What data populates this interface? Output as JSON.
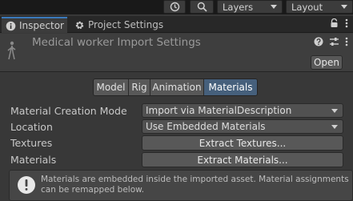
{
  "toolbar": {
    "history_icon": "history-icon",
    "search_icon": "search-icon",
    "layers_label": "Layers",
    "layout_label": "Layout"
  },
  "tabs": [
    {
      "label": "Inspector",
      "icon": "info-icon",
      "active": true
    },
    {
      "label": "Project Settings",
      "icon": "gear-icon",
      "active": false
    }
  ],
  "header": {
    "title": "Medical worker Import Settings",
    "open_label": "Open"
  },
  "segments": [
    {
      "label": "Model",
      "active": false
    },
    {
      "label": "Rig",
      "active": false
    },
    {
      "label": "Animation",
      "active": false
    },
    {
      "label": "Materials",
      "active": true
    }
  ],
  "fields": {
    "material_creation_mode": {
      "label": "Material Creation Mode",
      "value": "Import via MaterialDescription"
    },
    "location": {
      "label": "Location",
      "value": "Use Embedded Materials"
    },
    "textures": {
      "label": "Textures",
      "button": "Extract Textures..."
    },
    "materials": {
      "label": "Materials",
      "button": "Extract Materials..."
    }
  },
  "help": {
    "text": "Materials are embedded inside the imported asset. Material assignments can be remapped below."
  },
  "colors": {
    "active_tab_accent": "#3a79bb",
    "active_segment": "#46607c",
    "panel_bg": "#383838"
  }
}
